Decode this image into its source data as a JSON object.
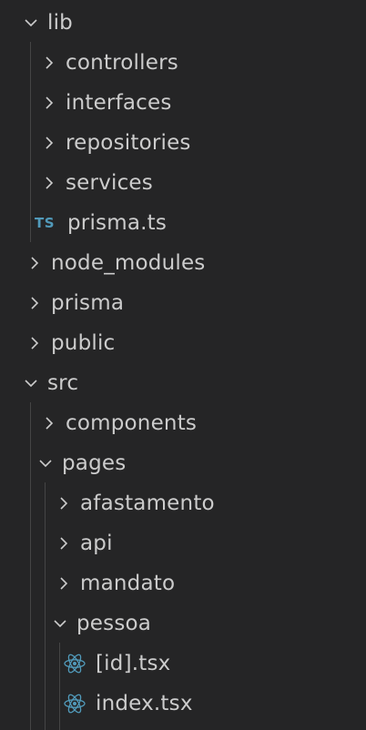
{
  "tree": {
    "lib": {
      "label": "lib"
    },
    "lib_controllers": {
      "label": "controllers"
    },
    "lib_interfaces": {
      "label": "interfaces"
    },
    "lib_repositories": {
      "label": "repositories"
    },
    "lib_services": {
      "label": "services"
    },
    "lib_prisma_ts": {
      "label": "prisma.ts",
      "icon_text": "TS",
      "icon": "typescript-icon"
    },
    "node_modules": {
      "label": "node_modules"
    },
    "prisma": {
      "label": "prisma"
    },
    "public": {
      "label": "public"
    },
    "src": {
      "label": "src"
    },
    "src_components": {
      "label": "components"
    },
    "src_pages": {
      "label": "pages"
    },
    "pages_afastamento": {
      "label": "afastamento"
    },
    "pages_api": {
      "label": "api"
    },
    "pages_mandato": {
      "label": "mandato"
    },
    "pages_pessoa": {
      "label": "pessoa"
    },
    "pessoa_id_tsx": {
      "label": "[id].tsx",
      "icon": "react-icon"
    },
    "pessoa_index_tsx": {
      "label": "index.tsx",
      "icon": "react-icon"
    }
  },
  "colors": {
    "background": "#252526",
    "text": "#cccccc",
    "typescript": "#519aba",
    "react": "#519aba",
    "indent_guide": "#454545"
  }
}
